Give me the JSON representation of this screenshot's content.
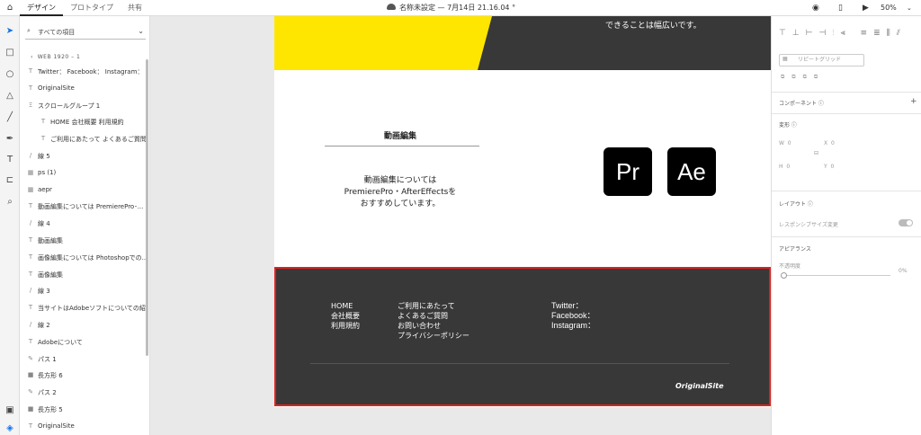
{
  "topbar": {
    "tabs": [
      "デザイン",
      "プロトタイプ",
      "共有"
    ],
    "document_title": "名称未設定 — 7月14日 21.16.04 °",
    "zoom": "50%"
  },
  "tools": [
    "select-arrow-icon",
    "rectangle-icon",
    "ellipse-icon",
    "triangle-icon",
    "line-icon",
    "pen-icon",
    "text-icon",
    "artboard-icon",
    "zoom-icon"
  ],
  "layers": {
    "search_label": "すべての項目",
    "artboard": "WEB 1920 – 1",
    "items": [
      {
        "icon": "T",
        "label": "Twitter： Facebook： Instagram：",
        "indent": 0
      },
      {
        "icon": "T",
        "label": "OriginalSite",
        "indent": 0
      },
      {
        "icon": "Ξ",
        "label": "スクロールグループ 1",
        "indent": 0
      },
      {
        "icon": "T",
        "label": "HOME 会社概要 利用規約",
        "indent": 1
      },
      {
        "icon": "T",
        "label": "ご利用にあたって よくあるご質問...",
        "indent": 1
      },
      {
        "icon": "/",
        "label": "線 5",
        "indent": 0
      },
      {
        "icon": "▦",
        "label": "ps (1)",
        "indent": 0
      },
      {
        "icon": "▦",
        "label": "aepr",
        "indent": 0
      },
      {
        "icon": "T",
        "label": "動画編集については PremierePro･...",
        "indent": 0
      },
      {
        "icon": "/",
        "label": "線 4",
        "indent": 0
      },
      {
        "icon": "T",
        "label": "動画編集",
        "indent": 0
      },
      {
        "icon": "T",
        "label": "画像編集については Photoshopでの...",
        "indent": 0
      },
      {
        "icon": "T",
        "label": "画像編集",
        "indent": 0
      },
      {
        "icon": "/",
        "label": "線 3",
        "indent": 0
      },
      {
        "icon": "T",
        "label": "当サイトはAdobeソフトについての紹...",
        "indent": 0
      },
      {
        "icon": "/",
        "label": "線 2",
        "indent": 0
      },
      {
        "icon": "T",
        "label": "Adobeについて",
        "indent": 0
      },
      {
        "icon": "✎",
        "label": "パス 1",
        "indent": 0
      },
      {
        "icon": "■",
        "label": "長方形 6",
        "indent": 0
      },
      {
        "icon": "✎",
        "label": "パス 2",
        "indent": 0
      },
      {
        "icon": "■",
        "label": "長方形 5",
        "indent": 0
      },
      {
        "icon": "T",
        "label": "OriginalSite",
        "indent": 0
      }
    ]
  },
  "artboard": {
    "hero_text": "できることは幅広いです。",
    "section_title": "動画編集",
    "description": [
      "動画編集については",
      "PremierePro・AfterEffectsを",
      "おすすめしています。"
    ],
    "icons": [
      "Pr",
      "Ae"
    ],
    "footer": {
      "col1": [
        "HOME",
        "会社概要",
        "利用規約"
      ],
      "col2": [
        "ご利用にあたって",
        "よくあるご質問",
        "お問い合わせ",
        "プライバシーポリシー"
      ],
      "col3": [
        "Twitter：",
        "Facebook：",
        "Instagram："
      ],
      "brand": "OriginalSite"
    },
    "colors": {
      "yellow": "#ffe600",
      "dark": "#383838",
      "selection": "#e02020"
    }
  },
  "properties": {
    "repeat_grid": "リピートグリッド",
    "component": "コンポーネント",
    "transform": "変形",
    "w_label": "W",
    "w_value": "0",
    "x_label": "X",
    "x_value": "0",
    "h_label": "H",
    "h_value": "0",
    "y_label": "Y",
    "y_value": "0",
    "layout": "レイアウト",
    "responsive": "レスポンシブサイズ変更",
    "appearance": "アピアランス",
    "opacity_label": "不透明度",
    "opacity_value": "0%"
  }
}
